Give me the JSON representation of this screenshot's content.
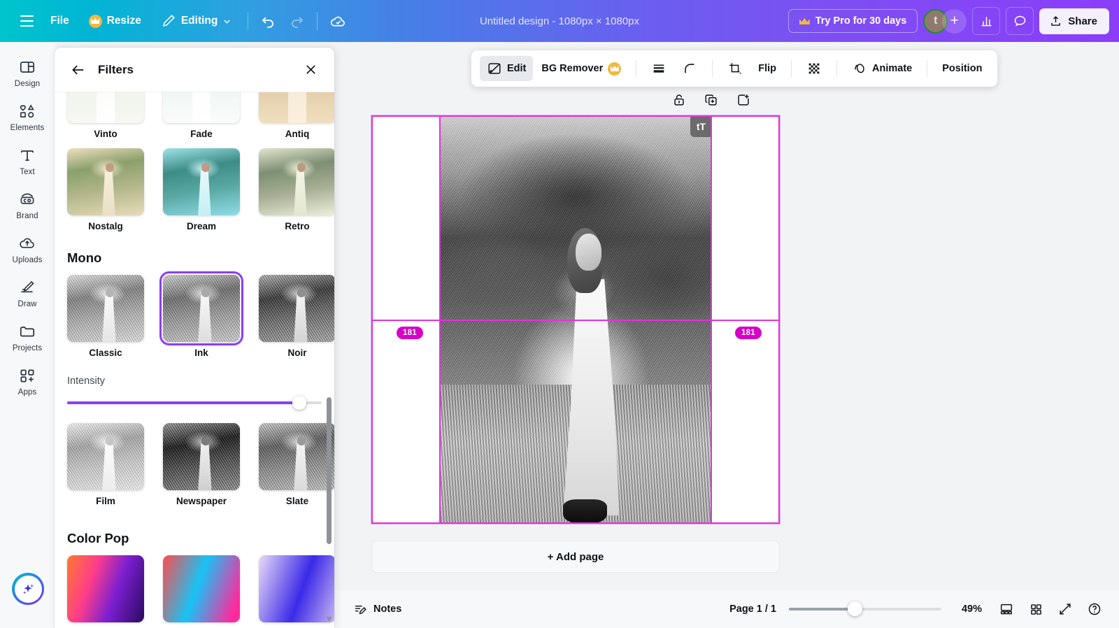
{
  "app": {
    "accent_purple": "#8b3dfa",
    "accent_teal": "#00c4cc",
    "magenta": "#e033dd",
    "badge_magenta": "#d600c8",
    "green_badge": "#1d8a2b"
  },
  "topbar": {
    "menu_icon": "hamburger-icon",
    "file_label": "File",
    "resize_label": "Resize",
    "resize_icon": "crown-icon",
    "editing_label": "Editing",
    "editing_chevron": "chevron-down-icon",
    "undo_icon": "undo-icon",
    "redo_icon": "redo-icon",
    "cloud_icon": "cloud-saved-icon",
    "doc_title": "Untitled design - 1080px × 1080px",
    "try_pro_label": "Try Pro for 30 days",
    "try_pro_icon": "crown-icon",
    "avatar_initial": "t",
    "avatar_add_label": "+",
    "insights_icon": "bar-chart-icon",
    "comment_icon": "speech-bubble-icon",
    "share_label": "Share",
    "share_icon": "upload-icon"
  },
  "rail": {
    "items": [
      {
        "label": "Design",
        "icon": "design-layout-icon"
      },
      {
        "label": "Elements",
        "icon": "shapes-icon"
      },
      {
        "label": "Text",
        "icon": "text-t-icon"
      },
      {
        "label": "Brand",
        "icon": "brand-badge-icon"
      },
      {
        "label": "Uploads",
        "icon": "cloud-upload-icon"
      },
      {
        "label": "Draw",
        "icon": "pencil-draw-icon"
      },
      {
        "label": "Projects",
        "icon": "folder-icon"
      },
      {
        "label": "Apps",
        "icon": "apps-grid-plus-icon"
      }
    ],
    "magic_button": "magic-sparkle-icon"
  },
  "panel": {
    "back_icon": "arrow-left-icon",
    "title": "Filters",
    "close_icon": "close-x-icon",
    "scroll_up_icon": "triangle-up-icon",
    "scroll_down_icon": "triangle-down-icon",
    "top_row": [
      {
        "label": "Vinto",
        "swatch": "linear-gradient(180deg,#e8efe3,#f4f6f1)"
      },
      {
        "label": "Fade",
        "swatch": "linear-gradient(180deg,#eef3f2,#f7faf9)"
      },
      {
        "label": "Antiq",
        "swatch": "linear-gradient(180deg,#e2c79c,#efdcb8)"
      }
    ],
    "second_row": [
      {
        "label": "Nostalg",
        "swatch": "linear-gradient(165deg,#f2e3c8,#cfd9b4 45%,#e7e0c6)"
      },
      {
        "label": "Dream",
        "swatch": "linear-gradient(165deg,#9fe3e8,#6fbfc4 45%,#bfeef1)"
      },
      {
        "label": "Retro",
        "swatch": "linear-gradient(165deg,#e6e8d2,#b9c5ab 45%,#eff0df)"
      }
    ],
    "mono": {
      "section_title": "Mono",
      "items": [
        {
          "label": "Classic",
          "selected": false,
          "tone": "linear-gradient(180deg,#d8d8d8,#8f8f8f 45%,#c9c9c9)"
        },
        {
          "label": "Ink",
          "selected": true,
          "tone": "linear-gradient(180deg,#cfcfcf,#7d7d7d 45%,#bdbdbd)"
        },
        {
          "label": "Noir",
          "selected": false,
          "tone": "linear-gradient(180deg,#b4b4b4,#4d4d4d 45%,#a5a5a5)"
        }
      ],
      "intensity_label": "Intensity",
      "intensity_value": 100,
      "second_items": [
        {
          "label": "Film",
          "tone": "linear-gradient(180deg,#dedede,#a8a8a8 45%,#d2d2d2)"
        },
        {
          "label": "Newspaper",
          "tone": "linear-gradient(180deg,#a6a6a6,#3c3c3c 45%,#9a9a9a)"
        },
        {
          "label": "Slate",
          "tone": "linear-gradient(180deg,#c4c4c4,#6f6f6f 45%,#b8b8b8)"
        }
      ]
    },
    "color_pop": {
      "section_title": "Color Pop",
      "items": [
        {
          "swatch": "linear-gradient(110deg,#ff7a2f,#ff3d8a 35%,#7b1fd1 70%,#2a0a5e)"
        },
        {
          "swatch": "linear-gradient(110deg,#ff4d4d,#17c3f5 45%,#ff2a9d 85%)"
        },
        {
          "swatch": "linear-gradient(110deg,#e9dbf7,#3b2ae8 55%,#c9b6f2)"
        }
      ]
    },
    "scrollbar": {
      "visible": true
    }
  },
  "object_toolbar": {
    "edit_label": "Edit",
    "edit_icon": "image-edit-icon",
    "edit_active": true,
    "bg_remover_label": "BG Remover",
    "bg_remover_icon": "crown-icon",
    "lines_icon": "line-weight-icon",
    "corner_icon": "corner-radius-icon",
    "crop_icon": "crop-icon",
    "flip_label": "Flip",
    "transparency_icon": "transparency-checker-icon",
    "animate_label": "Animate",
    "animate_icon": "animate-icon",
    "position_label": "Position"
  },
  "object_quick_tools": [
    {
      "icon": "lock-icon"
    },
    {
      "icon": "duplicate-icon"
    },
    {
      "icon": "add-to-page-icon"
    }
  ],
  "canvas": {
    "selection_badge_tt": "tT",
    "spacing_badge_left": "181",
    "spacing_badge_right": "181",
    "add_page_label": "+ Add page"
  },
  "bottombar": {
    "notes_label": "Notes",
    "notes_icon": "notes-pencil-icon",
    "page_indicator": "Page 1 / 1",
    "zoom_value": "49%",
    "zoom_percent": 49,
    "grid_view_icon": "page-view-icon",
    "thumbnails_icon": "grid-view-icon",
    "fullscreen_icon": "expand-icon",
    "help_icon": "help-question-icon"
  }
}
